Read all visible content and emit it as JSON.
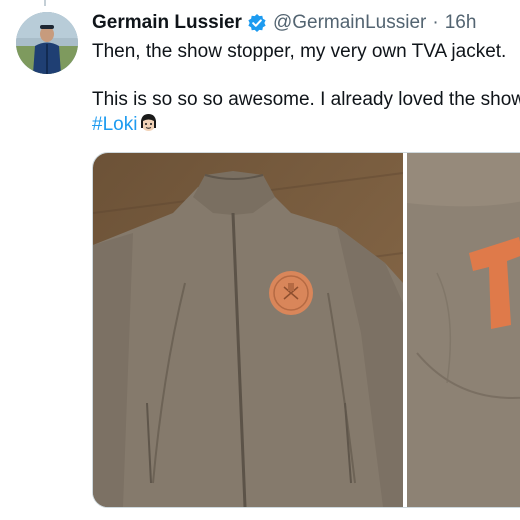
{
  "tweet": {
    "display_name": "Germain Lussier",
    "handle": "@GermainLussier",
    "separator": "·",
    "timestamp": "16h",
    "text_line_1": "Then, the show stopper, my very own TVA jacket.",
    "text_line_2": "This is so so so awesome. I already loved the show",
    "hashtag": "#Loki",
    "verified_icon": "verified-badge-icon",
    "emoji_icon": "loki-face-emoji"
  },
  "media": {
    "photos": [
      {
        "description_icon": "jacket-photo"
      },
      {
        "description_icon": "jacket-back-photo"
      }
    ]
  },
  "colors": {
    "link": "#1d9bf0",
    "text": "#0f1419",
    "secondary": "#536471",
    "jacket": "#857a6c",
    "logo_orange": "#d9865a"
  }
}
